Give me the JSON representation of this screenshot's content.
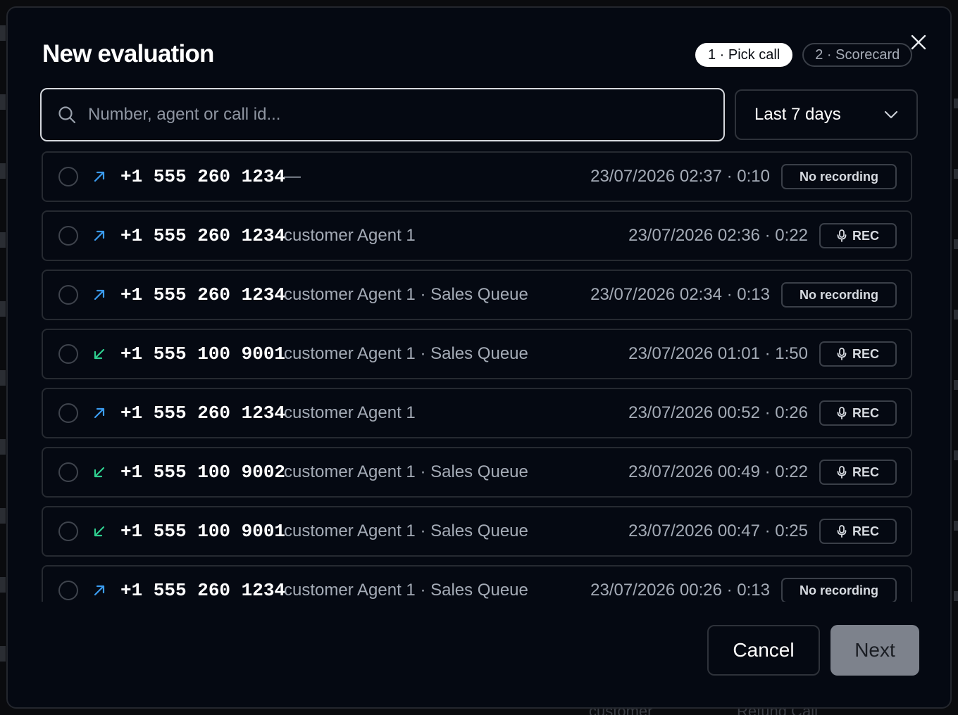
{
  "modal": {
    "title": "New evaluation",
    "steps": [
      {
        "label": "1 · Pick call",
        "active": true
      },
      {
        "label": "2 · Scorecard",
        "active": false
      }
    ],
    "close_icon": "close-icon"
  },
  "search": {
    "placeholder": "Number, agent or call id...",
    "value": "",
    "icon": "search-icon"
  },
  "filter": {
    "selected": "Last 7 days",
    "icon": "chevron-down-icon"
  },
  "calls": [
    {
      "direction": "outbound",
      "number": "+1 555 260 1234",
      "desc": "—",
      "datetime": "23/07/2026 02:37",
      "duration": "0:10",
      "meta": "23/07/2026 02:37 · 0:10",
      "recording": false,
      "badge": "No recording"
    },
    {
      "direction": "outbound",
      "number": "+1 555 260 1234",
      "desc": "customer Agent 1",
      "datetime": "23/07/2026 02:36",
      "duration": "0:22",
      "meta": "23/07/2026 02:36 · 0:22",
      "recording": true,
      "badge": "REC"
    },
    {
      "direction": "outbound",
      "number": "+1 555 260 1234",
      "desc": "customer Agent 1 · Sales Queue",
      "datetime": "23/07/2026 02:34",
      "duration": "0:13",
      "meta": "23/07/2026 02:34 · 0:13",
      "recording": false,
      "badge": "No recording"
    },
    {
      "direction": "inbound",
      "number": "+1 555 100 9001",
      "desc": "customer Agent 1 · Sales Queue",
      "datetime": "23/07/2026 01:01",
      "duration": "1:50",
      "meta": "23/07/2026 01:01 · 1:50",
      "recording": true,
      "badge": "REC"
    },
    {
      "direction": "outbound",
      "number": "+1 555 260 1234",
      "desc": "customer Agent 1",
      "datetime": "23/07/2026 00:52",
      "duration": "0:26",
      "meta": "23/07/2026 00:52 · 0:26",
      "recording": true,
      "badge": "REC"
    },
    {
      "direction": "inbound",
      "number": "+1 555 100 9002",
      "desc": "customer Agent 1 · Sales Queue",
      "datetime": "23/07/2026 00:49",
      "duration": "0:22",
      "meta": "23/07/2026 00:49 · 0:22",
      "recording": true,
      "badge": "REC"
    },
    {
      "direction": "inbound",
      "number": "+1 555 100 9001",
      "desc": "customer Agent 1 · Sales Queue",
      "datetime": "23/07/2026 00:47",
      "duration": "0:25",
      "meta": "23/07/2026 00:47 · 0:25",
      "recording": true,
      "badge": "REC"
    },
    {
      "direction": "outbound",
      "number": "+1 555 260 1234",
      "desc": "customer Agent 1 · Sales Queue",
      "datetime": "23/07/2026 00:26",
      "duration": "0:13",
      "meta": "23/07/2026 00:26 · 0:13",
      "recording": false,
      "badge": "No recording"
    }
  ],
  "footer": {
    "cancel_label": "Cancel",
    "next_label": "Next"
  },
  "background": {
    "peek_texts": [
      "customer",
      "Refund Call"
    ]
  },
  "colors": {
    "outbound_arrow": "#3b9cf0",
    "inbound_arrow": "#2fcf8f",
    "modal_bg": "#050912",
    "next_disabled": "#7d828c"
  }
}
